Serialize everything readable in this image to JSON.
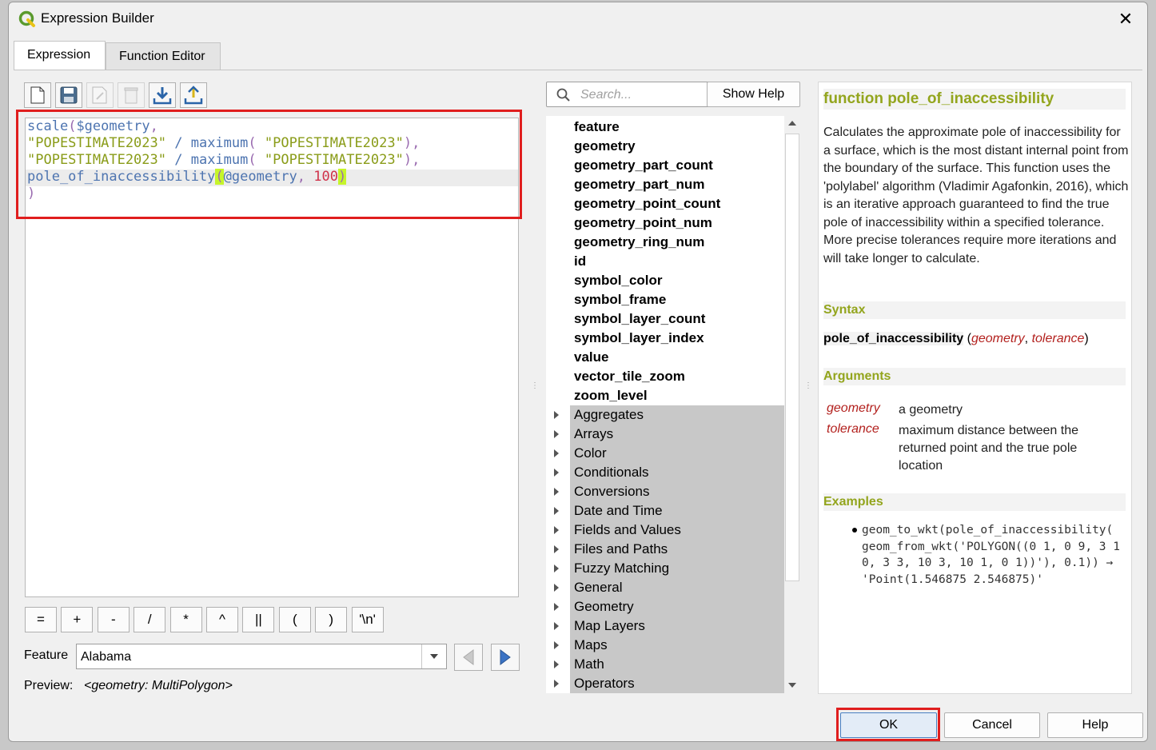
{
  "window": {
    "title": "Expression Builder"
  },
  "tabs": [
    {
      "label": "Expression"
    },
    {
      "label": "Function Editor"
    }
  ],
  "editor": {
    "lines": [
      [
        {
          "t": "scale",
          "c": "c-fn"
        },
        {
          "t": "(",
          "c": "c-par"
        },
        {
          "t": "$geometry",
          "c": "c-fn"
        },
        {
          "t": ",",
          "c": "c-par"
        }
      ],
      [
        {
          "t": "\"POPESTIMATE2023\"",
          "c": "c-str"
        },
        {
          "t": " / ",
          "c": "c-op"
        },
        {
          "t": "maximum",
          "c": "c-fn"
        },
        {
          "t": "( ",
          "c": "c-par"
        },
        {
          "t": "\"POPESTIMATE2023\"",
          "c": "c-str"
        },
        {
          "t": "),",
          "c": "c-par"
        }
      ],
      [
        {
          "t": "\"POPESTIMATE2023\"",
          "c": "c-str"
        },
        {
          "t": " / ",
          "c": "c-op"
        },
        {
          "t": "maximum",
          "c": "c-fn"
        },
        {
          "t": "( ",
          "c": "c-par"
        },
        {
          "t": "\"POPESTIMATE2023\"",
          "c": "c-str"
        },
        {
          "t": "),",
          "c": "c-par"
        }
      ],
      [
        {
          "t": "pole_of_inaccessibility",
          "c": "c-fn"
        },
        {
          "t": "(",
          "c": "c-par c-hl"
        },
        {
          "t": "@geometry",
          "c": "c-fn"
        },
        {
          "t": ", ",
          "c": "c-par"
        },
        {
          "t": "100",
          "c": "c-num"
        },
        {
          "t": ")",
          "c": "c-par c-hl"
        }
      ],
      [
        {
          "t": ")",
          "c": "c-par"
        }
      ]
    ]
  },
  "operators": [
    "=",
    "+",
    "-",
    "/",
    "*",
    "^",
    "||",
    "(",
    ")",
    "'\\n'"
  ],
  "feature": {
    "label": "Feature",
    "value": "Alabama"
  },
  "preview": {
    "label": "Preview:",
    "value": "<geometry: MultiPolygon>"
  },
  "search": {
    "placeholder": "Search..."
  },
  "show_help": "Show Help",
  "tree": {
    "leaves": [
      "feature",
      "geometry",
      "geometry_part_count",
      "geometry_part_num",
      "geometry_point_count",
      "geometry_point_num",
      "geometry_ring_num",
      "id",
      "symbol_color",
      "symbol_frame",
      "symbol_layer_count",
      "symbol_layer_index",
      "value",
      "vector_tile_zoom",
      "zoom_level"
    ],
    "groups": [
      "Aggregates",
      "Arrays",
      "Color",
      "Conditionals",
      "Conversions",
      "Date and Time",
      "Fields and Values",
      "Files and Paths",
      "Fuzzy Matching",
      "General",
      "Geometry",
      "Map Layers",
      "Maps",
      "Math",
      "Operators"
    ]
  },
  "help": {
    "title": "function pole_of_inaccessibility",
    "description": "Calculates the approximate pole of inaccessibility for a surface, which is the most distant internal point from the boundary of the surface. This function uses the 'polylabel' algorithm (Vladimir Agafonkin, 2016), which is an iterative approach guaranteed to find the true pole of inaccessibility within a specified tolerance. More precise tolerances require more iterations and will take longer to calculate.",
    "syntax_heading": "Syntax",
    "syntax_fn": "pole_of_inaccessibility",
    "syntax_open": " (",
    "syntax_arg1": "geometry",
    "syntax_comma": ", ",
    "syntax_arg2": "tolerance",
    "syntax_close": ")",
    "arguments_heading": "Arguments",
    "args": [
      {
        "name": "geometry",
        "desc": "a geometry"
      },
      {
        "name": "tolerance",
        "desc": "maximum distance between the returned point and the true pole location"
      }
    ],
    "examples_heading": "Examples",
    "example": "geom_to_wkt(pole_of_inaccessibility( geom_from_wkt('POLYGON((0 1, 0 9, 3 10, 3 3, 10 3, 10 1, 0 1))'), 0.1)) → 'Point(1.546875 2.546875)'"
  },
  "buttons": {
    "ok": "OK",
    "cancel": "Cancel",
    "help": "Help"
  }
}
